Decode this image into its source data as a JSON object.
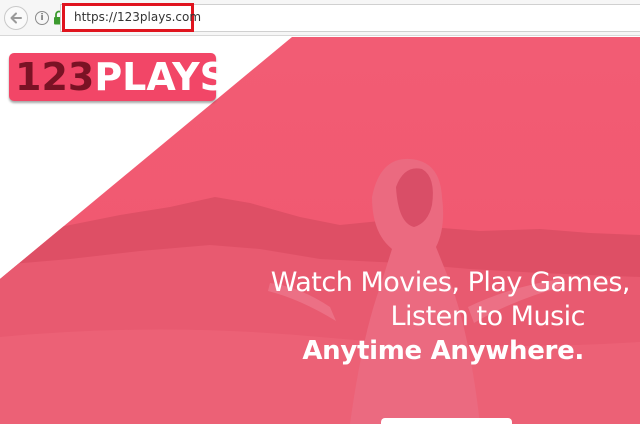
{
  "browser": {
    "url": "https://123plays.com",
    "info_icon_glyph": "i",
    "highlight_color": "#e0141e"
  },
  "logo": {
    "number": "123",
    "word": "PLAYS",
    "background_color": "#f24667"
  },
  "hero": {
    "line1": "Watch Movies, Play Games,",
    "line2": "Listen to Music",
    "line3": "Anytime Anywhere.",
    "overlay_color": "#f0566e"
  }
}
